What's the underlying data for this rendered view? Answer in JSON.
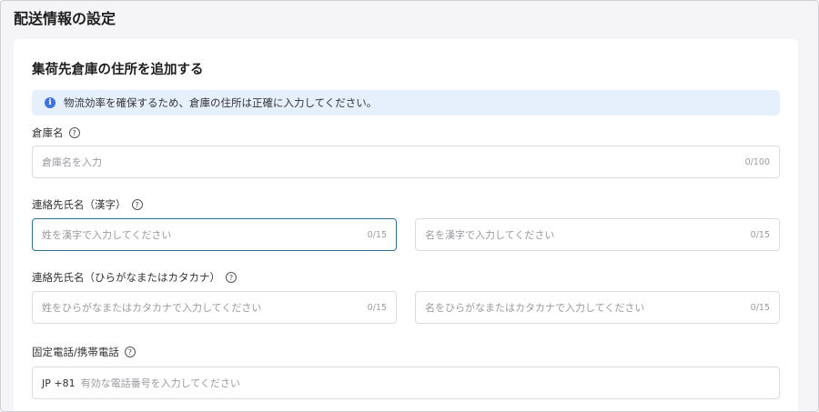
{
  "page": {
    "title": "配送情報の設定"
  },
  "card": {
    "title": "集荷先倉庫の住所を追加する"
  },
  "notice": {
    "text": "物流効率を確保するため、倉庫の住所は正確に入力してください。"
  },
  "fields": {
    "warehouse_name": {
      "label": "倉庫名",
      "placeholder": "倉庫名を入力",
      "counter": "0/100"
    },
    "contact_kanji": {
      "label": "連絡先氏名（漢字）",
      "last_placeholder": "姓を漢字で入力してください",
      "last_counter": "0/15",
      "first_placeholder": "名を漢字で入力してください",
      "first_counter": "0/15"
    },
    "contact_kana": {
      "label": "連絡先氏名（ひらがなまたはカタカナ）",
      "last_placeholder": "姓をひらがなまたはカタカナで入力してください",
      "last_counter": "0/15",
      "first_placeholder": "名をひらがなまたはカタカナで入力してください",
      "first_counter": "0/15"
    },
    "phone": {
      "label": "固定電話/携帯電話",
      "prefix": "JP +81",
      "placeholder": "有効な電話番号を入力してください"
    }
  },
  "icons": {
    "info": "info-icon",
    "help": "question-circle-icon"
  },
  "colors": {
    "accent": "#3b73e0",
    "notice_bg": "#e6f0fd",
    "focus_border": "#2e6f8e"
  }
}
